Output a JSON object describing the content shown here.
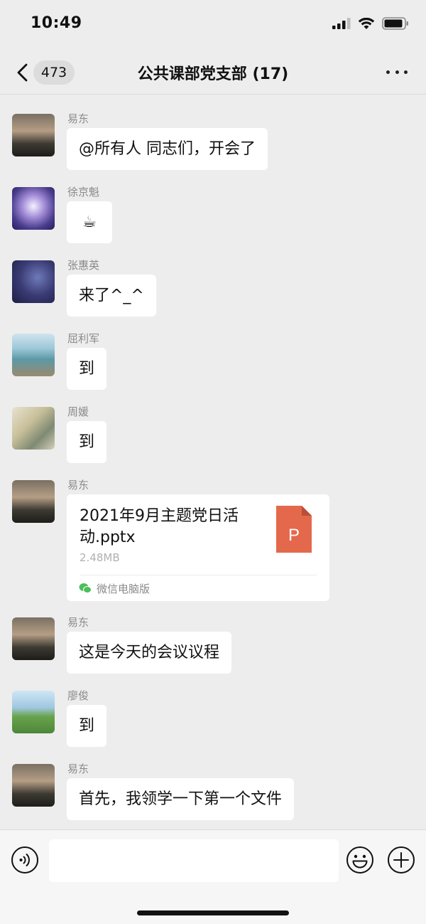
{
  "status": {
    "time": "10:49"
  },
  "nav": {
    "badge": "473",
    "title": "公共课部党支部 (17)"
  },
  "messages": [
    {
      "sender": "易东",
      "text": "@所有人 同志们，开会了"
    },
    {
      "sender": "徐京魁",
      "text": "☕"
    },
    {
      "sender": "张惠英",
      "text": "来了^_^"
    },
    {
      "sender": "屈利军",
      "text": "到"
    },
    {
      "sender": "周媛",
      "text": "到"
    },
    {
      "sender": "易东",
      "file": {
        "name": "2021年9月主题党日活动.pptx",
        "size": "2.48MB",
        "icon_letter": "P",
        "source": "微信电脑版"
      }
    },
    {
      "sender": "易东",
      "text": "这是今天的会议议程"
    },
    {
      "sender": "廖俊",
      "text": "到"
    },
    {
      "sender": "易东",
      "text": "首先，我领学一下第一个文件"
    }
  ],
  "colors": {
    "background": "#ededed",
    "bubble": "#ffffff",
    "ppt_icon": "#e4694c",
    "wechat_green": "#4cbf5a"
  },
  "icons": [
    "back-icon",
    "more-icon",
    "voice-icon",
    "emoji-icon",
    "plus-icon",
    "signal-icon",
    "wifi-icon",
    "battery-icon"
  ]
}
